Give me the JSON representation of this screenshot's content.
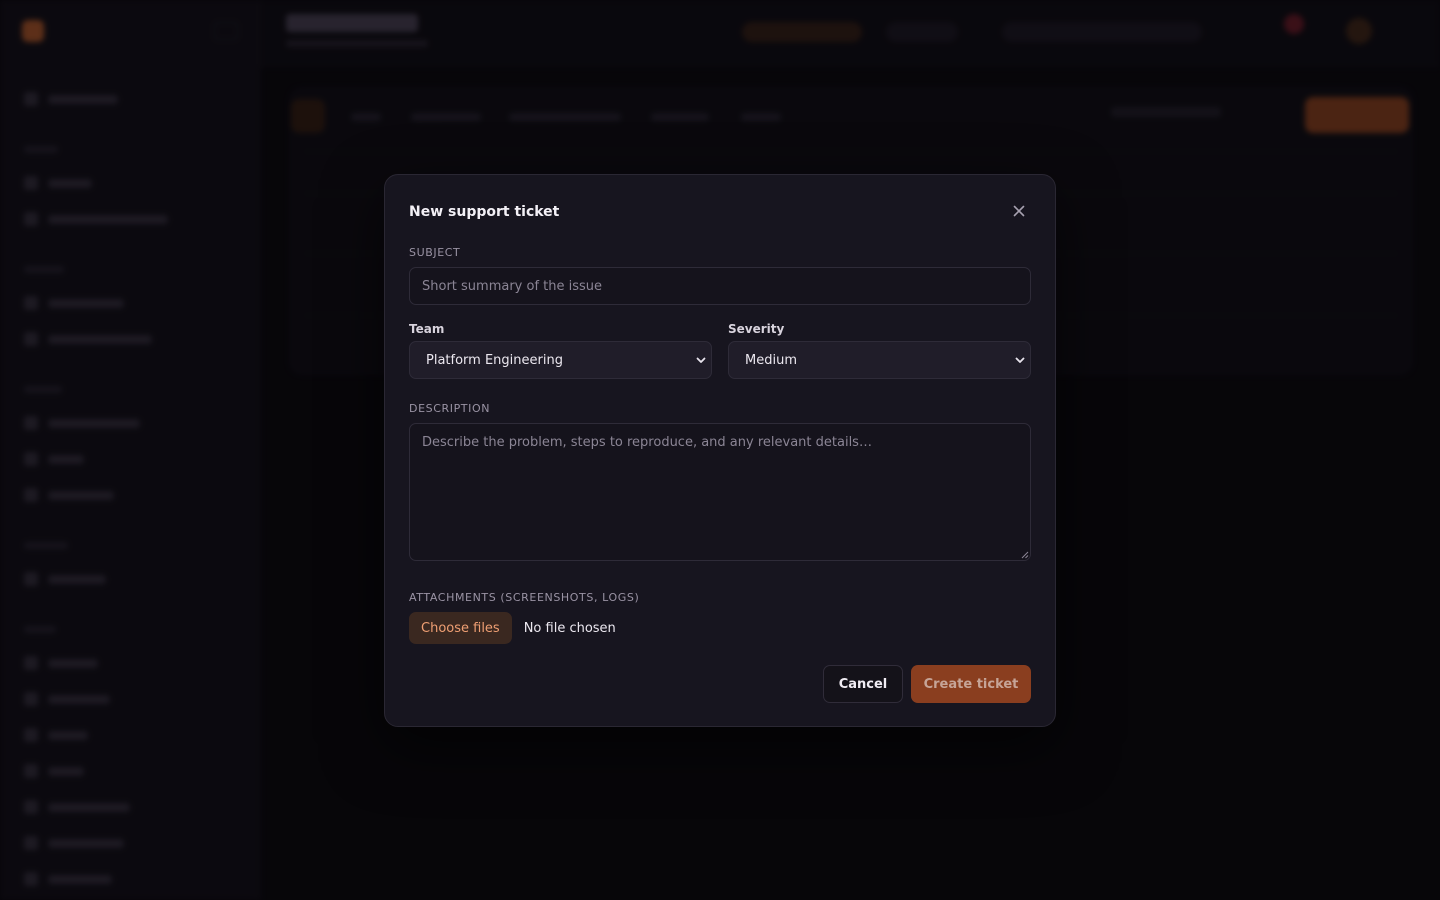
{
  "modal": {
    "title": "New support ticket",
    "subject": {
      "label": "SUBJECT",
      "placeholder": "Short summary of the issue",
      "value": ""
    },
    "team": {
      "label": "Team",
      "selected": "Platform Engineering"
    },
    "severity": {
      "label": "Severity",
      "selected": "Medium"
    },
    "description": {
      "label": "DESCRIPTION",
      "placeholder": "Describe the problem, steps to reproduce, and any relevant details…",
      "value": ""
    },
    "attachments": {
      "label": "ATTACHMENTS (SCREENSHOTS, LOGS)",
      "button_label": "Choose files",
      "status": "No file chosen"
    },
    "cancel_label": "Cancel",
    "submit_label": "Create ticket"
  },
  "icons": {
    "close": "close-icon",
    "select_chevron": "chevron-down-icon"
  },
  "colors": {
    "accent": "#c7652f",
    "modal_bg": "#17151f",
    "page_bg": "#0a090d",
    "submit_bg": "#8a3e1f",
    "file_button_text": "#ef9f73"
  }
}
